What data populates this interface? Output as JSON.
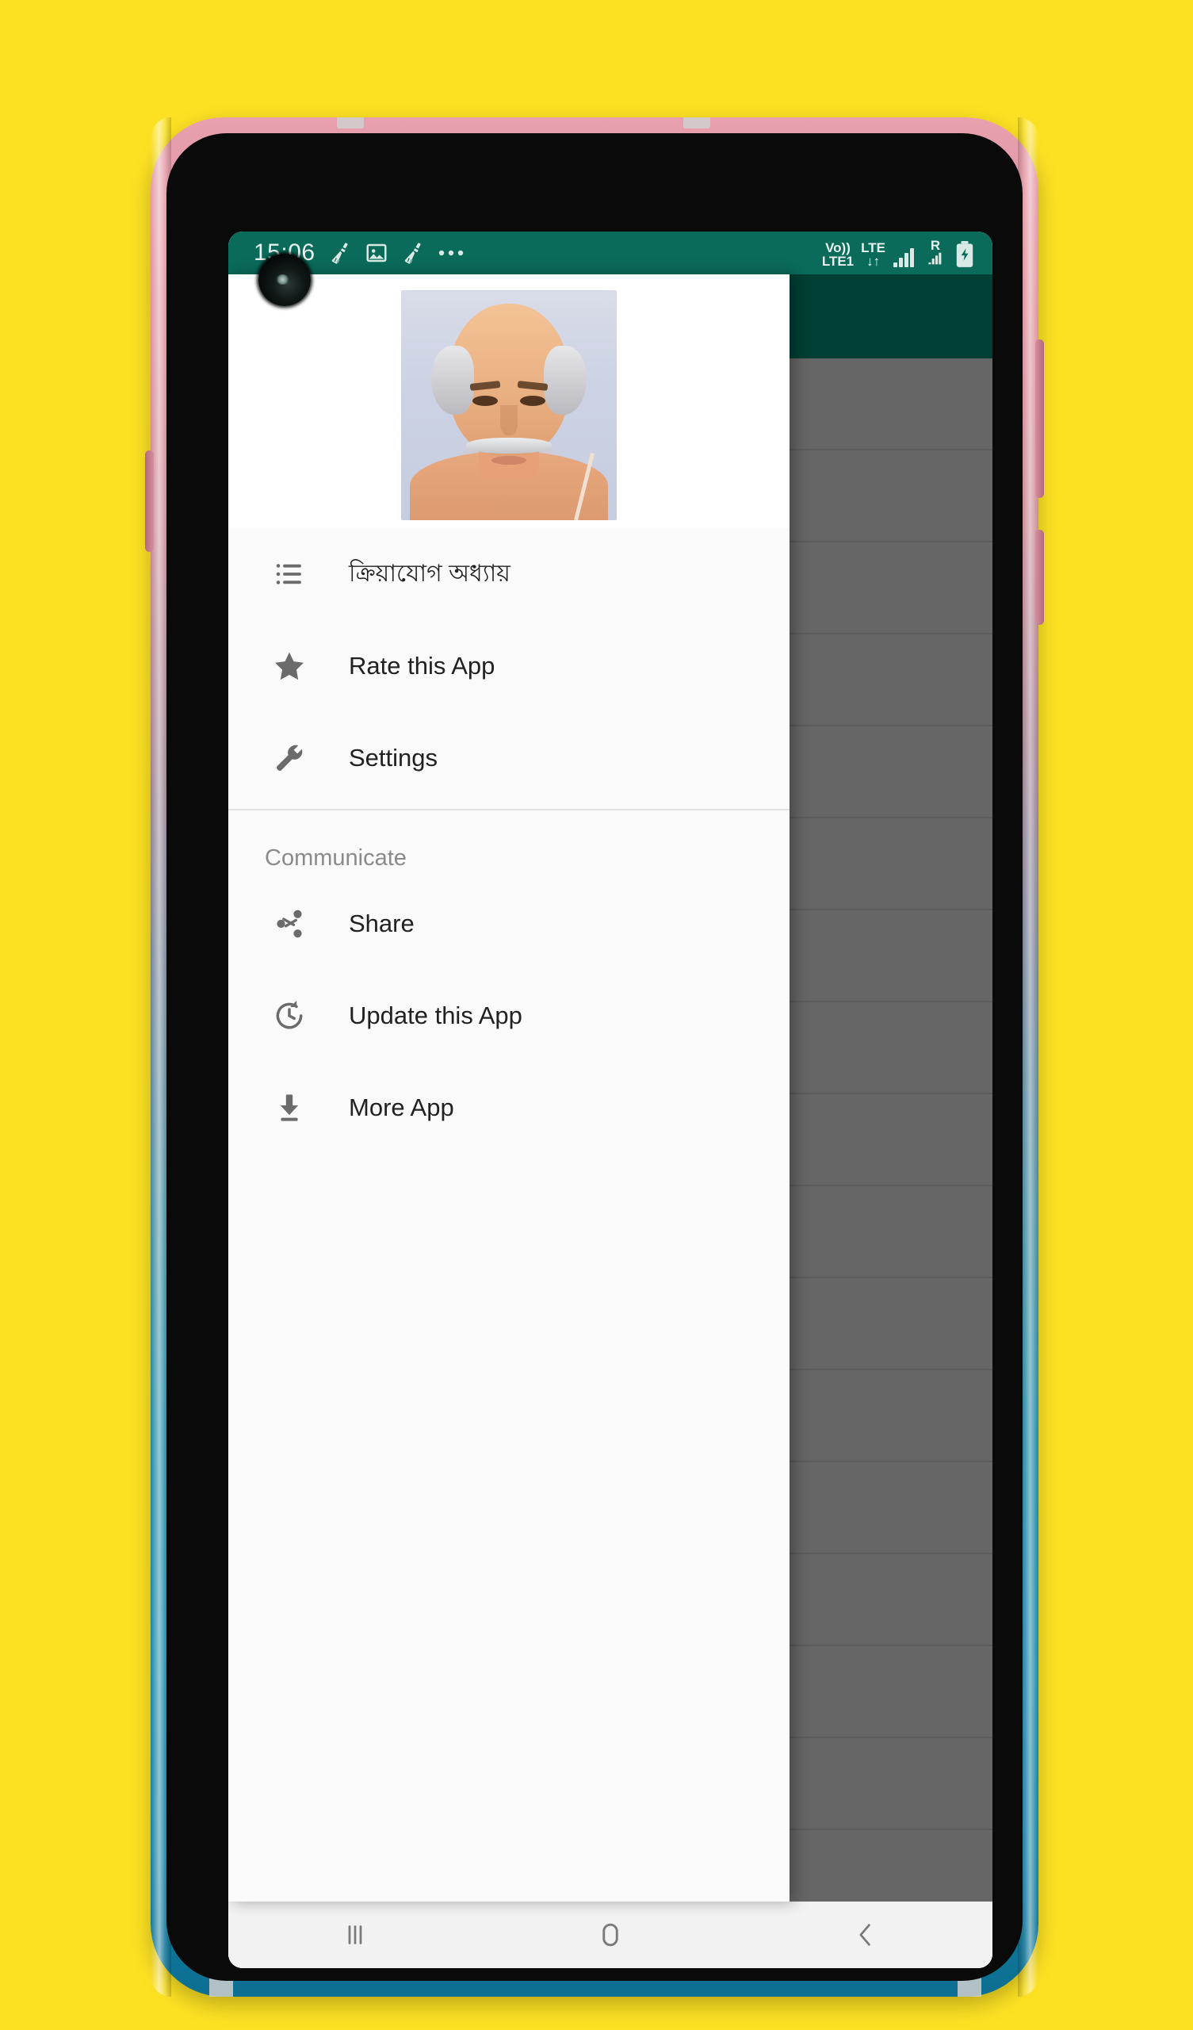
{
  "status_bar": {
    "time": "15:06",
    "left_icons": [
      "broom-icon",
      "image-icon",
      "broom-icon",
      "overflow-dots-icon"
    ],
    "volte_line1": "Vo))",
    "volte_line2": "LTE1",
    "lte_label": "LTE",
    "data_arrows": "↓↑",
    "roaming_label": "R",
    "battery": "battery-charging-icon",
    "bg_color": "#0a6b5b"
  },
  "drawer": {
    "header_image": "guru-portrait-image",
    "items": [
      {
        "icon": "list-icon",
        "label": "ক্রিয়াযোগ অধ্যায়",
        "name": "kriyajog-adhyay"
      },
      {
        "icon": "star-icon",
        "label": "Rate this App",
        "name": "rate-this-app"
      },
      {
        "icon": "wrench-icon",
        "label": "Settings",
        "name": "settings"
      }
    ],
    "section_title": "Communicate",
    "section_items": [
      {
        "icon": "share-icon",
        "label": "Share",
        "name": "share"
      },
      {
        "icon": "update-icon",
        "label": "Update this App",
        "name": "update-this-app"
      },
      {
        "icon": "download-icon",
        "label": "More App",
        "name": "more-app"
      }
    ],
    "bg_color": "#fafafa"
  },
  "background_activity": {
    "appbar_color": "#003f33",
    "list_color": "#666666",
    "row_count": 16
  },
  "system_nav": {
    "recents": "recents-icon",
    "home": "home-icon",
    "back": "back-icon"
  },
  "device": {
    "frame_top_color": "#e8a0ae",
    "frame_bottom_color": "#0d6f92",
    "wallpaper_color": "#FCE123"
  }
}
